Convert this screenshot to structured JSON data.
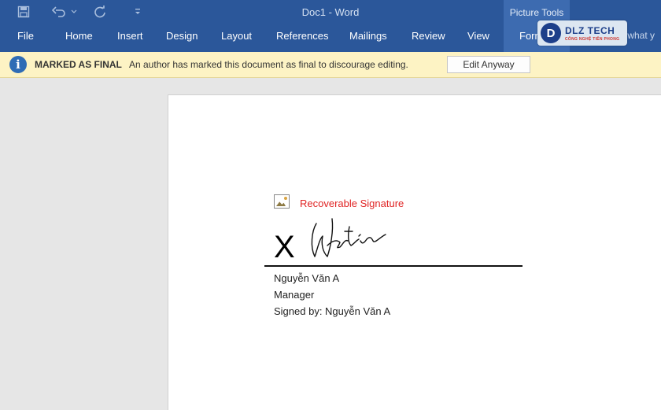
{
  "window": {
    "title": "Doc1 - Word",
    "context_tab_group": "Picture Tools"
  },
  "ribbon": {
    "tabs": [
      "File",
      "Home",
      "Insert",
      "Design",
      "Layout",
      "References",
      "Mailings",
      "Review",
      "View",
      "Format"
    ],
    "tell_me": "Tell me what y"
  },
  "logo": {
    "brand": "DLZ TECH",
    "tagline": "CÔNG NGHỆ TIÊN PHONG"
  },
  "message_bar": {
    "icon": "info-icon",
    "title": "MARKED AS FINAL",
    "text": "An author has marked this document as final to discourage editing.",
    "button": "Edit Anyway"
  },
  "document": {
    "signature": {
      "status": "Recoverable Signature",
      "x_mark": "X",
      "signer_name": "Nguyễn Văn A",
      "signer_title": "Manager",
      "signed_by": "Signed by: Nguyễn Văn A"
    }
  },
  "colors": {
    "title_bar": "#2b579a",
    "message_bar": "#fdf3c4",
    "signature_status": "#e02424"
  }
}
